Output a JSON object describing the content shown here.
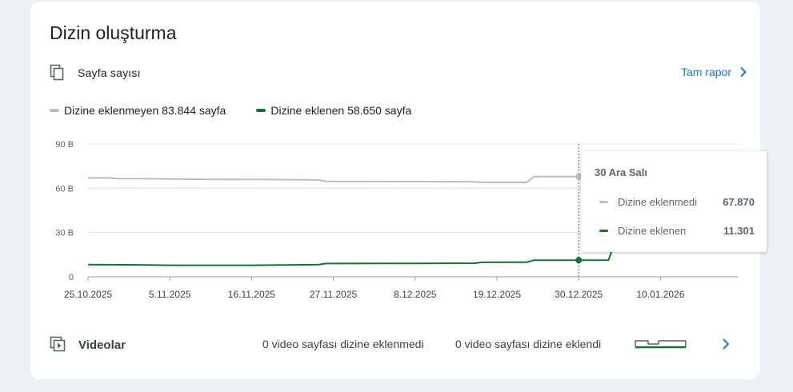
{
  "card": {
    "title": "Dizin oluşturma",
    "pages_label": "Sayfa sayısı",
    "full_report": "Tam rapor",
    "legend": {
      "not_indexed": "Dizine eklenmeyen 83.844 sayfa",
      "indexed": "Dizine eklenen 58.650 sayfa"
    },
    "videos": {
      "label": "Videolar",
      "not_indexed": "0 video sayfası dizine eklenmedi",
      "indexed": "0 video sayfası dizine eklendi"
    }
  },
  "icons": {
    "pages": "copy-pages-icon",
    "videos": "video-library-icon",
    "chevron": "chevron-right-icon"
  },
  "colors": {
    "not_indexed": "#bdbdbd",
    "indexed": "#137333",
    "link": "#1a73e8"
  },
  "tooltip": {
    "date": "30 Ara Salı",
    "not_indexed_label": "Dizine eklenmedi",
    "not_indexed_value": "67.870",
    "indexed_label": "Dizine eklenen",
    "indexed_value": "11.301"
  },
  "chart_data": {
    "type": "line",
    "x_tick_labels": [
      "25.10.2025",
      "5.11.2025",
      "16.11.2025",
      "27.11.2025",
      "8.12.2025",
      "19.12.2025",
      "30.12.2025",
      "10.01.2026"
    ],
    "y_tick_labels": [
      "0",
      "30 B",
      "60 B",
      "90 B"
    ],
    "ylim": [
      0,
      90000
    ],
    "grid": true,
    "highlight_date": "2025-12-30",
    "series": [
      {
        "name": "Dizine eklenmeyen",
        "color": "#bdbdbd",
        "points": [
          [
            "2025-10-25",
            67000
          ],
          [
            "2025-10-28",
            67000
          ],
          [
            "2025-10-29",
            66500
          ],
          [
            "2025-11-01",
            66500
          ],
          [
            "2025-11-05",
            66300
          ],
          [
            "2025-11-10",
            66100
          ],
          [
            "2025-11-16",
            66000
          ],
          [
            "2025-11-22",
            65800
          ],
          [
            "2025-11-25",
            65600
          ],
          [
            "2025-11-26",
            64700
          ],
          [
            "2025-11-27",
            64600
          ],
          [
            "2025-12-08",
            64500
          ],
          [
            "2025-12-16",
            64400
          ],
          [
            "2025-12-17",
            64000
          ],
          [
            "2025-12-23",
            64000
          ],
          [
            "2025-12-24",
            67870
          ],
          [
            "2025-12-30",
            67870
          ],
          [
            "2026-01-03",
            67870
          ],
          [
            "2026-01-04",
            76000
          ],
          [
            "2026-01-09",
            76000
          ],
          [
            "2026-01-10",
            61000
          ],
          [
            "2026-01-14",
            61000
          ],
          [
            "2026-01-15",
            67000
          ],
          [
            "2026-01-17",
            67000
          ],
          [
            "2026-01-18",
            84000
          ],
          [
            "2026-01-19",
            84000
          ]
        ]
      },
      {
        "name": "Dizine eklenen",
        "color": "#137333",
        "points": [
          [
            "2025-10-25",
            8300
          ],
          [
            "2025-10-28",
            8200
          ],
          [
            "2025-11-02",
            8000
          ],
          [
            "2025-11-05",
            7800
          ],
          [
            "2025-11-16",
            7800
          ],
          [
            "2025-11-22",
            8100
          ],
          [
            "2025-11-25",
            8300
          ],
          [
            "2025-11-26",
            9000
          ],
          [
            "2025-12-08",
            9100
          ],
          [
            "2025-12-16",
            9200
          ],
          [
            "2025-12-17",
            9800
          ],
          [
            "2025-12-23",
            9900
          ],
          [
            "2025-12-24",
            11301
          ],
          [
            "2025-12-30",
            11301
          ],
          [
            "2026-01-03",
            11301
          ],
          [
            "2026-01-04",
            25000
          ],
          [
            "2026-01-05",
            31000
          ],
          [
            "2026-01-09",
            31000
          ],
          [
            "2026-01-10",
            68000
          ],
          [
            "2026-01-14",
            68000
          ],
          [
            "2026-01-15",
            79000
          ],
          [
            "2026-01-17",
            79000
          ],
          [
            "2026-01-18",
            60000
          ],
          [
            "2026-01-19",
            60000
          ]
        ]
      }
    ]
  }
}
